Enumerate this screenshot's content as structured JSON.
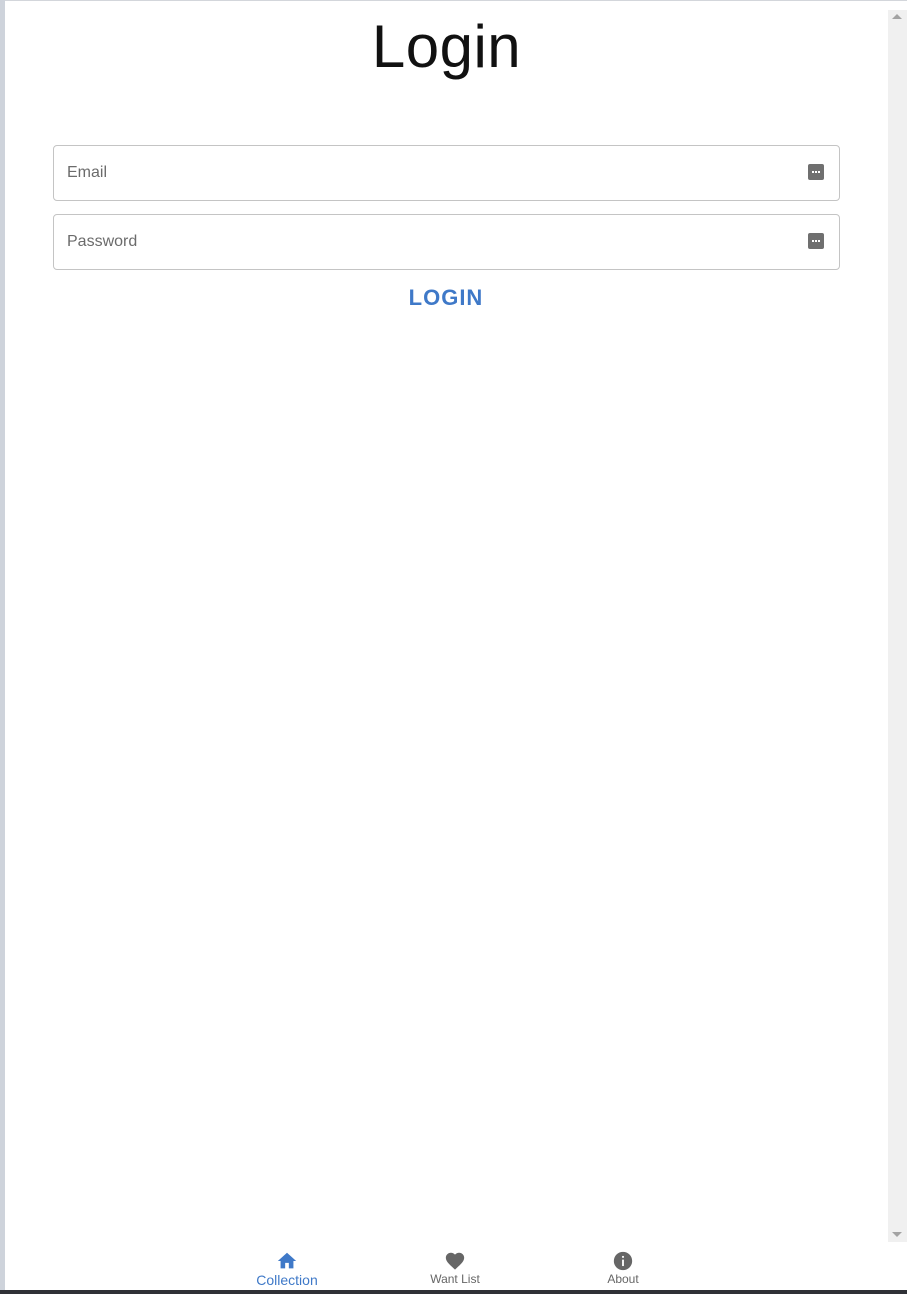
{
  "page": {
    "title": "Login"
  },
  "form": {
    "email_placeholder": "Email",
    "password_placeholder": "Password",
    "login_label": "LOGIN"
  },
  "bottom_nav": {
    "items": [
      {
        "label": "Collection",
        "icon": "home-icon",
        "active": true
      },
      {
        "label": "Want List",
        "icon": "heart-icon",
        "active": false
      },
      {
        "label": "About",
        "icon": "info-icon",
        "active": false
      }
    ]
  },
  "colors": {
    "accent": "#3f79c8",
    "inactive": "#666666",
    "border": "#c4c4c4",
    "title_text": "#111111"
  }
}
